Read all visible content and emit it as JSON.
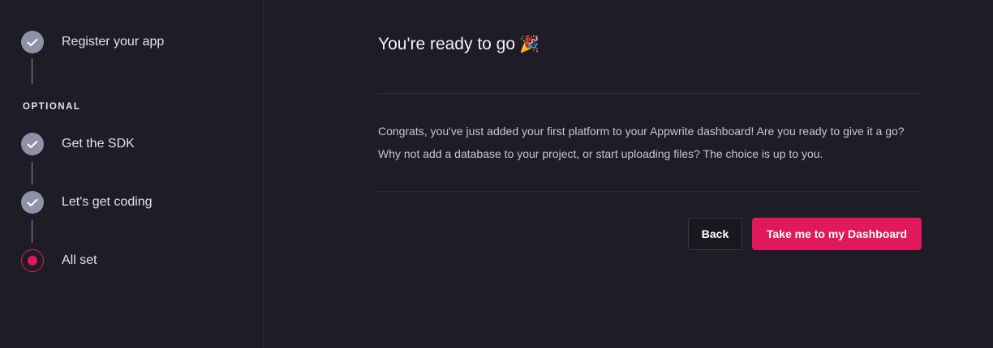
{
  "sidebar": {
    "section_label": "OPTIONAL",
    "steps": [
      {
        "label": "Register your app",
        "state": "done"
      },
      {
        "label": "Get the SDK",
        "state": "done"
      },
      {
        "label": "Let's get coding",
        "state": "done"
      },
      {
        "label": "All set",
        "state": "active"
      }
    ]
  },
  "main": {
    "title": "You're ready to go",
    "title_emoji": "🎉",
    "body": "Congrats, you've just added your first platform to your Appwrite dashboard! Are you ready to give it a go? Why not add a database to your project, or start uploading files? The choice is up to you.",
    "back_label": "Back",
    "primary_label": "Take me to my Dashboard"
  },
  "colors": {
    "background": "#1d1c27",
    "accent": "#e0195a",
    "step_done": "#8f91a7"
  },
  "icons": {
    "step_done": "check-icon",
    "step_active": "current-step-icon",
    "title": "party-popper-icon"
  }
}
